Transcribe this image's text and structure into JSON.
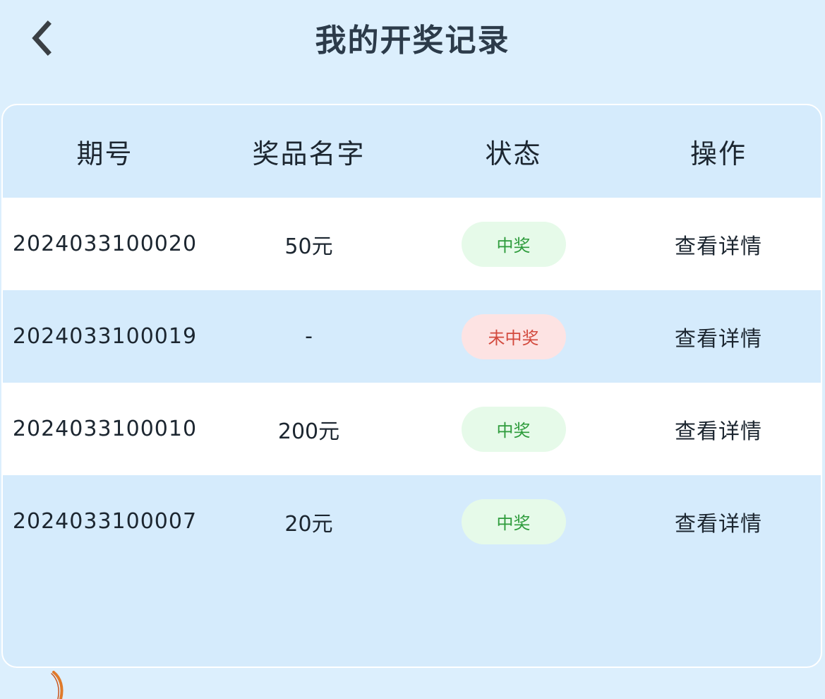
{
  "header": {
    "title": "我的开奖记录",
    "back_icon": "chevron-left-icon"
  },
  "table": {
    "columns": [
      "期号",
      "奖品名字",
      "状态",
      "操作"
    ],
    "rows": [
      {
        "period": "2024033100020",
        "prize": "50元",
        "status": "中奖",
        "status_type": "win",
        "action": "查看详情"
      },
      {
        "period": "2024033100019",
        "prize": "-",
        "status": "未中奖",
        "status_type": "lose",
        "action": "查看详情"
      },
      {
        "period": "2024033100010",
        "prize": "200元",
        "status": "中奖",
        "status_type": "win",
        "action": "查看详情"
      },
      {
        "period": "2024033100007",
        "prize": "20元",
        "status": "中奖",
        "status_type": "win",
        "action": "查看详情"
      }
    ]
  },
  "colors": {
    "background": "#dceffd",
    "card": "#d5ebfc",
    "win_badge_bg": "#e6fae9",
    "win_badge_text": "#2e9c3c",
    "lose_badge_bg": "#fde3e3",
    "lose_badge_text": "#d34a3e"
  }
}
